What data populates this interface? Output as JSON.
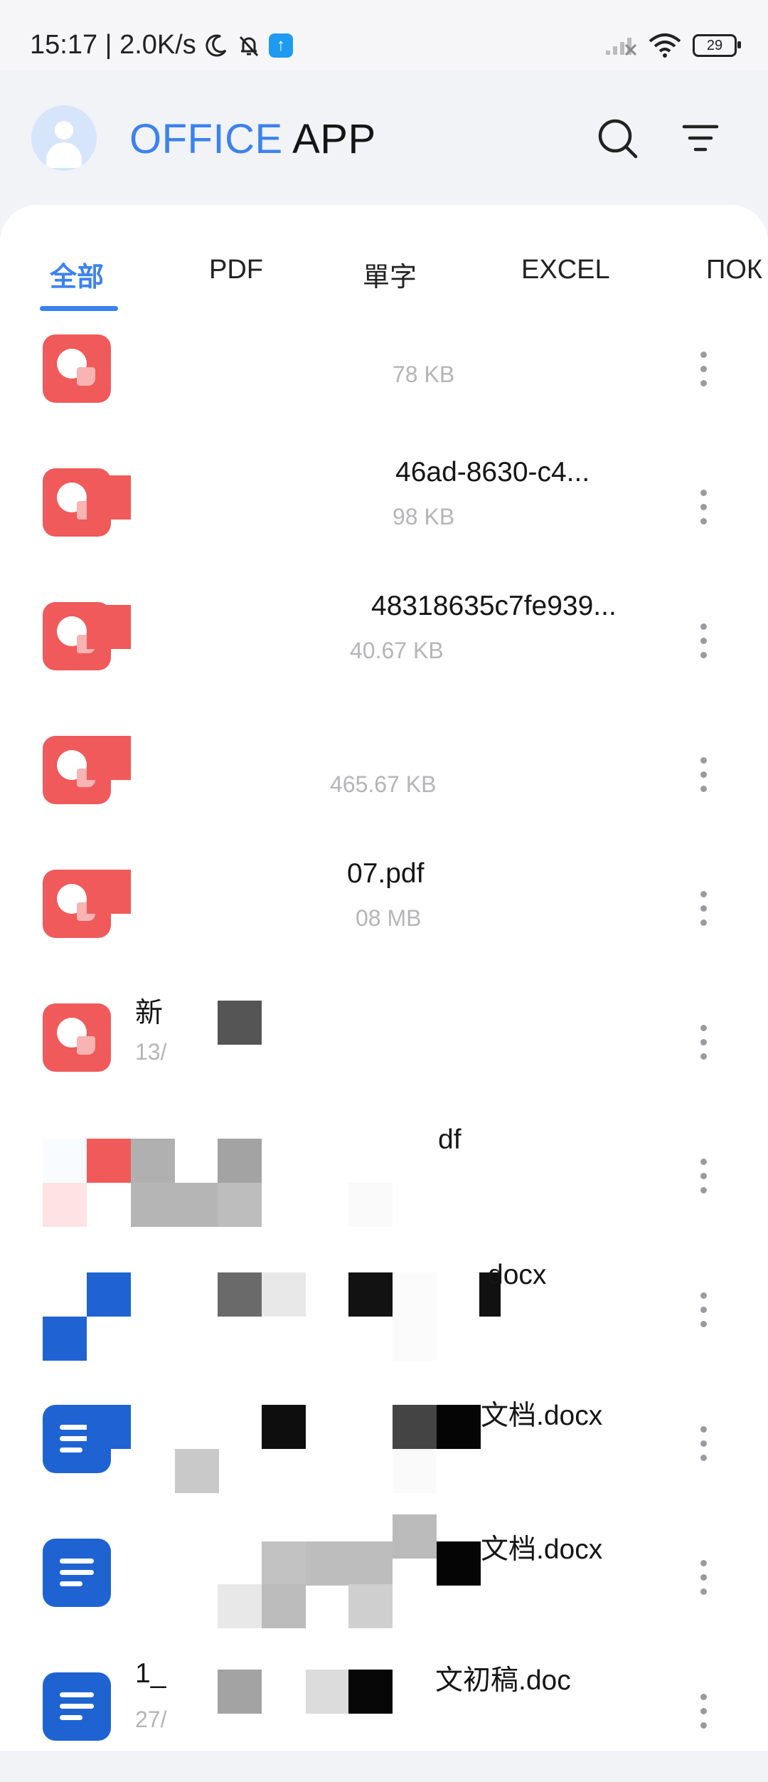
{
  "status_bar": {
    "time_speed": "15:17 | 2.0K/s",
    "battery": "29",
    "icons": [
      "moon-icon",
      "bell-off-icon",
      "upload-icon",
      "signal-icon",
      "wifi-icon",
      "battery-icon"
    ]
  },
  "header": {
    "brand_part1": "OFFICE",
    "brand_part2": "APP",
    "icons": [
      "avatar",
      "search-icon",
      "filter-icon"
    ]
  },
  "colors": {
    "accent": "#3b82f0",
    "pdf": "#f05a5a",
    "doc": "#1f63d3"
  },
  "tabs": [
    {
      "label": "全部",
      "active": true
    },
    {
      "label": "PDF",
      "active": false
    },
    {
      "label": "單字",
      "active": false
    },
    {
      "label": "EXCEL",
      "active": false
    },
    {
      "label": "ПОК",
      "active": false
    }
  ],
  "files": [
    {
      "type": "pdf",
      "name": "",
      "meta": "78 KB"
    },
    {
      "type": "pdf",
      "name": "46ad-8630-c4...",
      "meta": "98 KB"
    },
    {
      "type": "pdf",
      "name": "48318635c7fe939...",
      "meta": "40.67 KB"
    },
    {
      "type": "pdf",
      "name": "",
      "meta": "465.67 KB"
    },
    {
      "type": "pdf",
      "name": "07.pdf",
      "meta": "08 MB"
    },
    {
      "type": "pdf",
      "name": "新",
      "meta": "13/"
    },
    {
      "type": "pdf",
      "name": "df",
      "meta": ""
    },
    {
      "type": "doc",
      "name": "docx",
      "meta": ""
    },
    {
      "type": "doc",
      "name": "文档.docx",
      "meta": ""
    },
    {
      "type": "doc",
      "name": "文档.docx",
      "meta": ""
    },
    {
      "type": "doc",
      "name": "文初稿.doc",
      "meta": "27/"
    }
  ]
}
